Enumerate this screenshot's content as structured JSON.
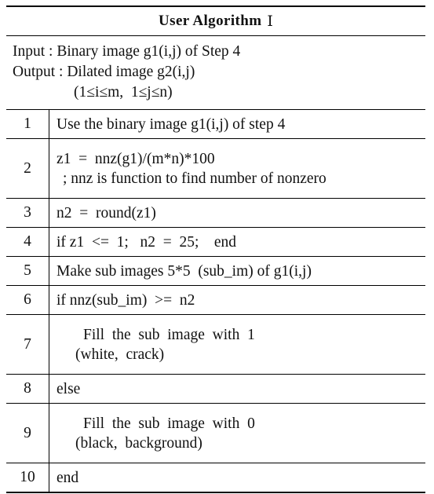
{
  "table": {
    "title": "User Algorithm",
    "title_numeral": "Ⅰ",
    "io": {
      "input_line": "Input : Binary image g1(i,j) of Step 4",
      "output_line": "Output : Dilated image g2(i,j)",
      "range_line": "(1≤i≤m,  1≤j≤n)"
    },
    "steps": [
      {
        "num": "1",
        "lines": [
          {
            "text": "Use the binary image g1(i,j) of step 4",
            "indent": "none"
          }
        ]
      },
      {
        "num": "2",
        "lines": [
          {
            "text": "z1  =  nnz(g1)/(m*n)*100",
            "indent": "none"
          },
          {
            "text": "; nnz is function to find number of nonzero",
            "indent": "sub"
          }
        ]
      },
      {
        "num": "3",
        "lines": [
          {
            "text": "n2  =  round(z1)",
            "indent": "none"
          }
        ]
      },
      {
        "num": "4",
        "lines": [
          {
            "text": "if z1  <=  1;   n2  =  25;    end",
            "indent": "none"
          }
        ]
      },
      {
        "num": "5",
        "lines": [
          {
            "text": "Make sub images 5*5  (sub_im) of g1(i,j)",
            "indent": "none"
          }
        ]
      },
      {
        "num": "6",
        "lines": [
          {
            "text": "if nnz(sub_im)  >=  n2",
            "indent": "none"
          }
        ]
      },
      {
        "num": "7",
        "lines": [
          {
            "text": "Fill  the  sub  image  with  1",
            "indent": "ind"
          },
          {
            "text": "(white,  crack)",
            "indent": "ind2"
          }
        ]
      },
      {
        "num": "8",
        "lines": [
          {
            "text": "else",
            "indent": "none"
          }
        ]
      },
      {
        "num": "9",
        "lines": [
          {
            "text": "Fill  the  sub  image  with  0",
            "indent": "ind"
          },
          {
            "text": "(black,  background)",
            "indent": "ind2"
          }
        ]
      },
      {
        "num": "10",
        "lines": [
          {
            "text": "end",
            "indent": "none"
          }
        ]
      }
    ]
  }
}
